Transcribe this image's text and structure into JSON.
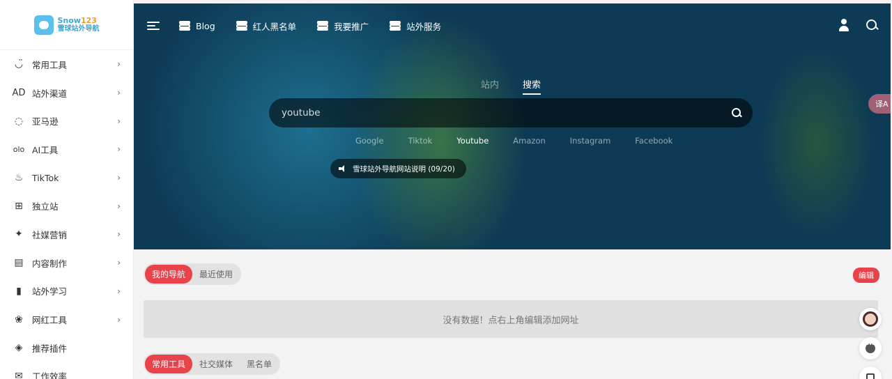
{
  "logo": {
    "line1_a": "Snow",
    "line1_b": "123",
    "line2": "雪球站外导航"
  },
  "sidebar": {
    "items": [
      {
        "label": "常用工具",
        "icon": "smile-icon",
        "arrow": "›"
      },
      {
        "label": "站外渠道",
        "icon": "ad-icon",
        "arrow": "›"
      },
      {
        "label": "亚马逊",
        "icon": "amazon-icon",
        "arrow": "›"
      },
      {
        "label": "AI工具",
        "icon": "ai-icon",
        "arrow": "›"
      },
      {
        "label": "TikTok",
        "icon": "fire-icon",
        "arrow": "›"
      },
      {
        "label": "独立站",
        "icon": "windows-icon",
        "arrow": "›"
      },
      {
        "label": "社媒营销",
        "icon": "twitter-icon",
        "arrow": "›"
      },
      {
        "label": "内容制作",
        "icon": "document-icon",
        "arrow": "›"
      },
      {
        "label": "站外学习",
        "icon": "book-icon",
        "arrow": "›"
      },
      {
        "label": "网红工具",
        "icon": "huawei-icon",
        "arrow": "›"
      },
      {
        "label": "推荐插件",
        "icon": "layers-icon",
        "arrow": ""
      },
      {
        "label": "工作效率",
        "icon": "mail-icon",
        "arrow": ""
      }
    ]
  },
  "topnav": {
    "items": [
      {
        "label": "Blog"
      },
      {
        "label": "红人黑名单"
      },
      {
        "label": "我要推广"
      },
      {
        "label": "站外服务"
      }
    ]
  },
  "search": {
    "tabs": [
      {
        "label": "站内"
      },
      {
        "label": "搜索"
      }
    ],
    "value": "youtube",
    "engines": [
      {
        "label": "Google"
      },
      {
        "label": "Tiktok"
      },
      {
        "label": "Youtube"
      },
      {
        "label": "Amazon"
      },
      {
        "label": "Instagram"
      },
      {
        "label": "Facebook"
      }
    ]
  },
  "notice": {
    "text": "雪球站外导航网站说明 (09/20)"
  },
  "translate": {
    "label": "译A"
  },
  "my_nav": {
    "tabs": [
      {
        "label": "我的导航"
      },
      {
        "label": "最近使用"
      }
    ],
    "edit_label": "编辑",
    "empty_text": "没有数据！点右上角编辑添加网址"
  },
  "section2": {
    "tabs": [
      {
        "label": "常用工具"
      },
      {
        "label": "社交媒体"
      },
      {
        "label": "黑名单"
      }
    ]
  },
  "colors": {
    "accent": "#e8434a",
    "brand": "#3aa6d8"
  }
}
